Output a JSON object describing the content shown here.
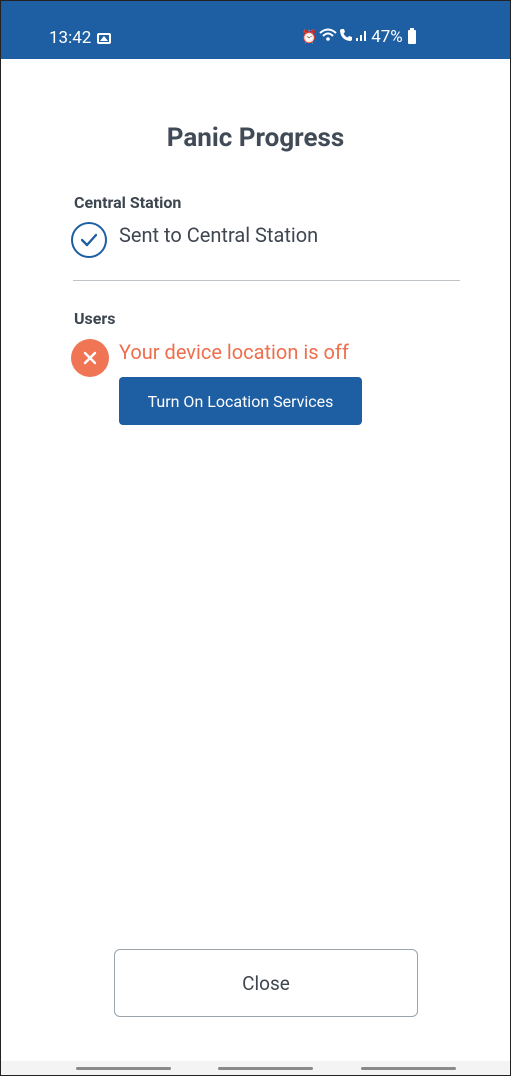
{
  "status_bar": {
    "time": "13:42",
    "battery": "47%",
    "color": "#1e5fa3"
  },
  "page": {
    "title": "Panic Progress"
  },
  "central_station": {
    "label": "Central Station",
    "status_text": "Sent to Central Station",
    "status_icon": "check-circle-icon"
  },
  "users": {
    "label": "Users",
    "error_text": "Your device location is off",
    "error_icon": "error-circle-icon",
    "error_color": "#ee6e4d",
    "button_label": "Turn On Location Services"
  },
  "footer": {
    "close_label": "Close"
  }
}
